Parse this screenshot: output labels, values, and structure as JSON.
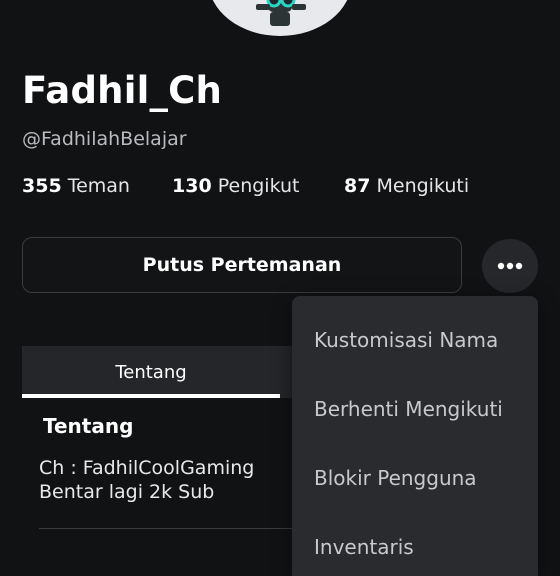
{
  "profile": {
    "display_name": "Fadhil_Ch",
    "handle": "@FadhilahBelajar"
  },
  "stats": {
    "friends_count": "355",
    "friends_label": "Teman",
    "followers_count": "130",
    "followers_label": "Pengikut",
    "following_count": "87",
    "following_label": "Mengikuti"
  },
  "actions": {
    "unfriend_label": "Putus Pertemanan",
    "more_icon": "ellipsis-icon"
  },
  "tabs": {
    "about_label": "Tentang"
  },
  "about": {
    "title": "Tentang",
    "line1": "Ch : FadhilCoolGaming",
    "line2": "Bentar lagi 2k Sub"
  },
  "menu": {
    "items": [
      "Kustomisasi Nama",
      "Berhenti Mengikuti",
      "Blokir Pengguna",
      "Inventaris"
    ]
  },
  "colors": {
    "background": "#111214",
    "menu_background": "#2a2b2f",
    "menu_text": "#c8c9cc",
    "secondary_text": "#b9bbbe"
  }
}
